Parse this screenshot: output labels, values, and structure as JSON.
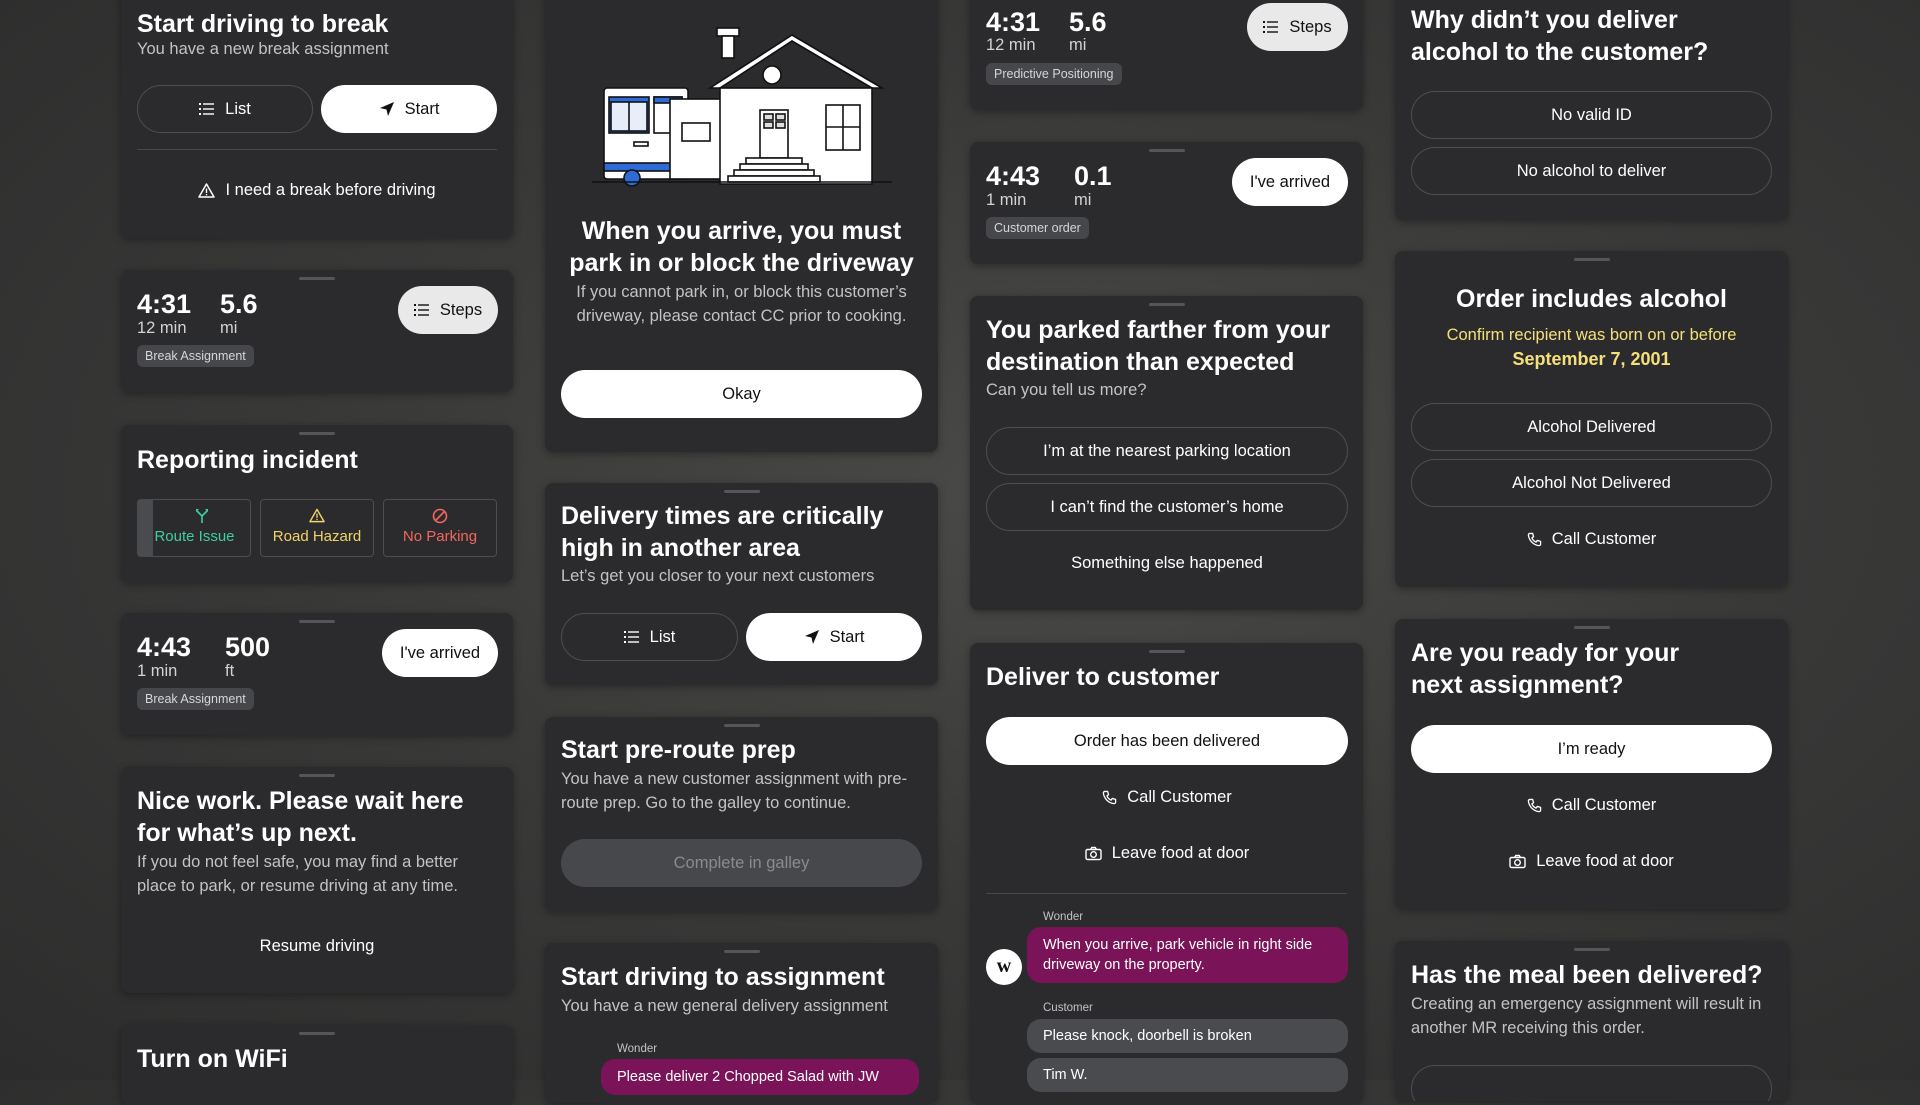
{
  "col1": {
    "break_start": {
      "title": "Start driving to break",
      "subtitle": "You have a new break assignment",
      "list_label": "List",
      "start_label": "Start",
      "need_break_label": "I need a break before driving"
    },
    "break_nav": {
      "time": "4:31",
      "time_unit": "12 min",
      "distance": "5.6",
      "distance_unit": "mi",
      "tag": "Break Assignment",
      "steps_label": "Steps"
    },
    "incident": {
      "title": "Reporting incident",
      "options": [
        "Route Issue",
        "Road Hazard",
        "No Parking"
      ]
    },
    "break_arrive": {
      "time": "4:43",
      "time_unit": "1 min",
      "distance": "500",
      "distance_unit": "ft",
      "tag": "Break Assignment",
      "arrived_label": "I've arrived"
    },
    "wait": {
      "title": "Nice work. Please wait here for what’s up next.",
      "subtitle": "If you do not feel safe, you may find a better place to park, or resume driving at any time.",
      "resume_label": "Resume driving"
    },
    "wifi": {
      "title": "Turn on WiFi"
    }
  },
  "col2": {
    "driveway": {
      "title": "When you arrive, you must park in or block the driveway",
      "subtitle": "If you cannot park in, or block this customer’s driveway, please contact CC prior to cooking.",
      "okay_label": "Okay"
    },
    "critical": {
      "title": "Delivery times are critically high in another area",
      "subtitle": "Let’s get you closer to your next customers",
      "list_label": "List",
      "start_label": "Start"
    },
    "preroute": {
      "title": "Start pre-route prep",
      "subtitle": "You have a new customer assignment with pre-route prep. Go to the galley to continue.",
      "complete_label": "Complete in galley"
    },
    "assignment": {
      "title": "Start driving to assignment",
      "subtitle": "You have a new general delivery assignment",
      "chat_name": "Wonder",
      "chat_text": "Please deliver 2 Chopped Salad with JW"
    }
  },
  "col3": {
    "predictive": {
      "time": "4:31",
      "time_unit": "12 min",
      "distance": "5.6",
      "distance_unit": "mi",
      "tag": "Predictive Positioning",
      "steps_label": "Steps"
    },
    "customer_arrive": {
      "time": "4:43",
      "time_unit": "1 min",
      "distance": "0.1",
      "distance_unit": "mi",
      "tag": "Customer order",
      "arrived_label": "I've arrived"
    },
    "parked": {
      "title": "You parked farther from your destination than expected",
      "subtitle": "Can you tell us more?",
      "options": [
        "I’m at the nearest parking location",
        "I can’t find the customer’s home",
        "Something else happened"
      ]
    },
    "deliver": {
      "title": "Deliver to customer",
      "delivered_label": "Order has been delivered",
      "call_label": "Call Customer",
      "leave_label": "Leave food at door",
      "chat_wonder_name": "Wonder",
      "chat_wonder_text": "When you arrive, park vehicle in right side driveway on the property.",
      "avatar_letter": "w",
      "chat_customer_name": "Customer",
      "chat_customer_text": "Please knock, doorbell is broken",
      "chat_customer_text2": "Tim W."
    }
  },
  "col4": {
    "alcohol_reason": {
      "title": "Why didn’t you deliver alcohol to the customer?",
      "options": [
        "No valid ID",
        "No alcohol to deliver"
      ]
    },
    "alcohol": {
      "title": "Order includes alcohol",
      "confirm_text": "Confirm recipient was born on or before",
      "date": "September 7, 2001",
      "delivered_label": "Alcohol Delivered",
      "not_delivered_label": "Alcohol Not Delivered",
      "call_label": "Call Customer"
    },
    "ready": {
      "title": "Are you ready for your next assignment?",
      "ready_label": "I’m ready",
      "call_label": "Call Customer",
      "leave_label": "Leave food at door"
    },
    "meal": {
      "title": "Has the meal been delivered?",
      "subtitle": "Creating an emergency assignment will result in another MR receiving this order."
    }
  },
  "colors": {
    "accent_purple": "#7a1358",
    "route_green": "#3fcf9c",
    "hazard_yellow": "#f1d36a",
    "parking_red": "#f0675f",
    "alcohol_yellow": "#f3e07a"
  }
}
